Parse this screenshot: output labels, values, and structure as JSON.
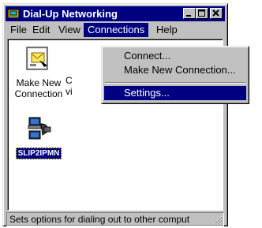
{
  "window": {
    "title": "Dial-Up Networking"
  },
  "menubar": {
    "file": "File",
    "edit": "Edit",
    "view": "View",
    "connections": "Connections",
    "help": "Help"
  },
  "icons": [
    {
      "label_line1": "Make New",
      "label_line2": "Connection",
      "icon": "make-new-connection-icon"
    },
    {
      "label_line1": "C",
      "label_line2": "vi",
      "icon": "connection-icon"
    },
    {
      "label": "SLIP2IPMN",
      "icon": "dialup-connection-icon",
      "selected": true
    }
  ],
  "connections_menu": {
    "items": [
      {
        "label": "Connect...",
        "highlighted": false
      },
      {
        "label": "Make New Connection...",
        "highlighted": false
      },
      {
        "label": "Settings...",
        "highlighted": true
      }
    ]
  },
  "statusbar": {
    "text": "Sets options for dialing out to other comput"
  },
  "colors": {
    "titlebar": "#000080",
    "selection": "#000080",
    "face": "#c0c0c0"
  }
}
